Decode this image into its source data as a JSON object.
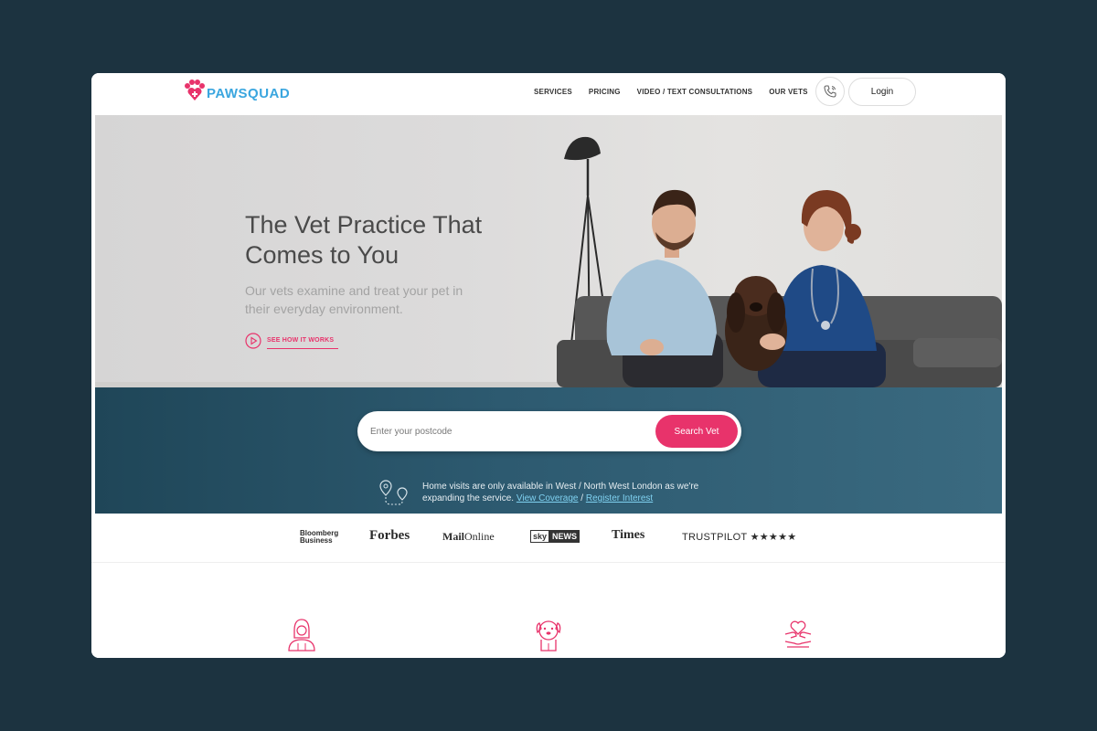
{
  "header": {
    "logo_text": "PAWSQUAD",
    "nav": [
      "SERVICES",
      "PRICING",
      "VIDEO / TEXT CONSULTATIONS",
      "OUR VETS"
    ],
    "login_label": "Login"
  },
  "hero": {
    "title": "The Vet Practice That Comes to You",
    "subtitle": "Our vets examine and treat your pet in their everyday environment.",
    "cta": "SEE HOW IT WORKS"
  },
  "search": {
    "placeholder": "Enter your postcode",
    "button_label": "Search Vet",
    "notice_text": "Home visits are only available in West / North West London as we're expanding the service.",
    "link_coverage": "View Coverage",
    "link_separator": "/",
    "link_register": "Register Interest"
  },
  "press": {
    "bloomberg_line1": "Bloomberg",
    "bloomberg_line2": "Business",
    "forbes": "Forbes",
    "mail_bold": "Mail",
    "mail_light": "Online",
    "sky_a": "sky",
    "sky_b": "NEWS",
    "times": "Times",
    "trustpilot": "TRUSTPILOT ★★★★★"
  },
  "colors": {
    "accent": "#e8336b",
    "brand_blue": "#3aa6df",
    "band": "#2d5a70",
    "frame_bg": "#1c3340"
  },
  "icons": [
    "paw-heart-logo-icon",
    "phone-icon",
    "play-circle-icon",
    "map-pin-route-icon",
    "vet-person-icon",
    "dog-icon",
    "heart-hands-icon"
  ]
}
